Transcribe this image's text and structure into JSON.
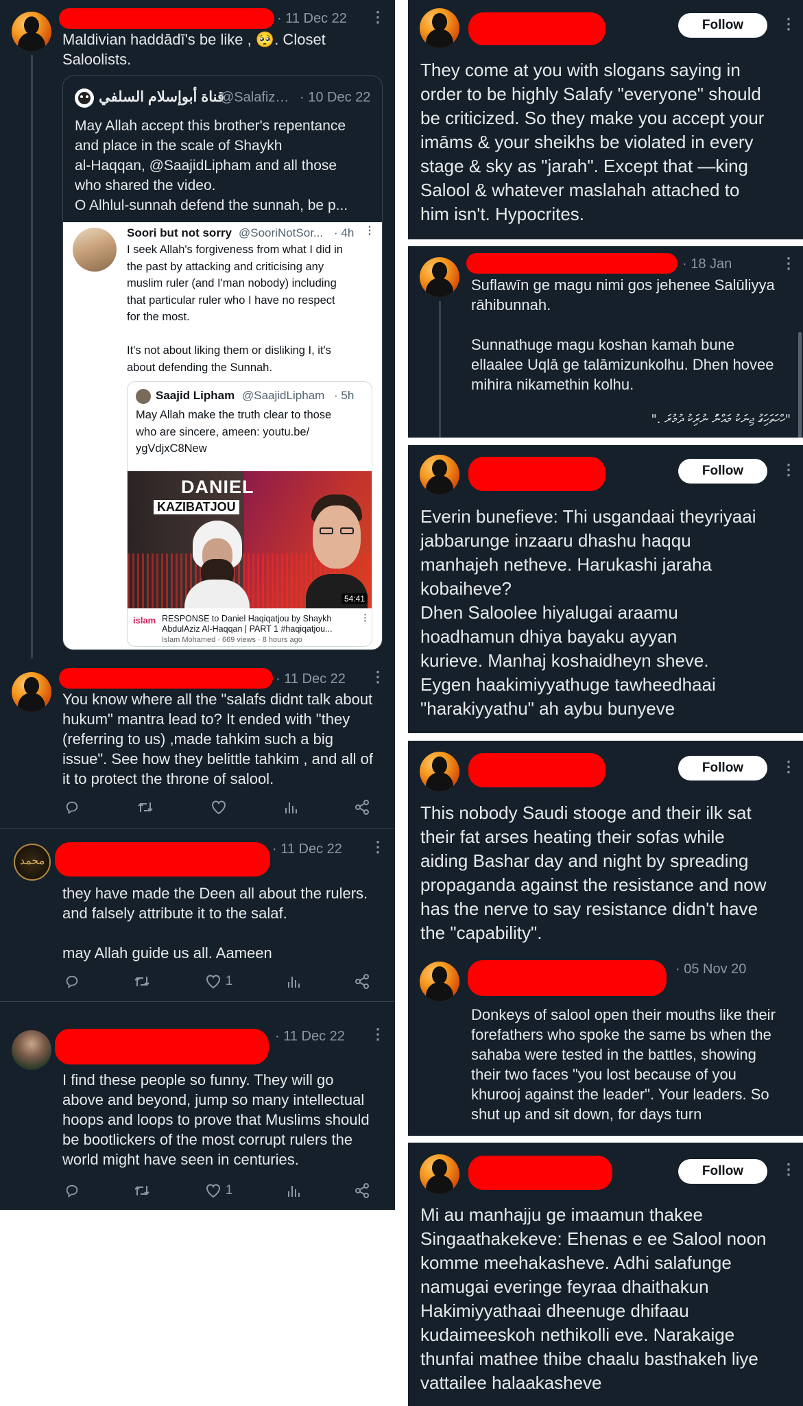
{
  "left": {
    "tweet1": {
      "date": "· 11 Dec 22",
      "text": "Maldivian haddādī's be like , 🥺. Closet\nSaloolists.",
      "quote": {
        "author": "قناة أبوإسلام السلفي",
        "handle": "@Salafiz…",
        "date": "· 10 Dec 22",
        "text": "May Allah accept this brother's repentance\nand place in the scale of Shaykh\nal-Haqqan, @SaajidLipham and all those\nwho shared the video.\nO Alhlul-sunnah defend the sunnah, be p...",
        "inner": {
          "name": "Soori but not sorry",
          "handle": "@SooriNotSor...",
          "date": "· 4h",
          "text": "I seek Allah's forgiveness from what I did in\nthe past by attacking and criticising any\nmuslim ruler (and I'man nobody) including\nthat particular ruler who I have no respect\nfor the most.\n\nIt's not about liking them or disliking I, it's\nabout defending the Sunnah.",
          "nested": {
            "name": "Saajid Lipham",
            "handle": "@SaajidLipham",
            "date": "· 5h",
            "text": "May Allah make the truth clear to those\nwho are sincere, ameen: youtu.be/\nygVdjxC8New",
            "thumb_title": "DANIEL",
            "thumb_sub": "KAZIBATJOU",
            "duration": "54:41",
            "video_title": "RESPONSE to Daniel Haqiqatjou by Shaykh\nAbdulAziz Al-Haqqan | PART 1 #haqiqatjou...",
            "video_meta": "Islam Mohamed · 669 views · 8 hours ago",
            "channel_logo": "islam"
          }
        }
      }
    },
    "tweet2": {
      "date": "· 11 Dec 22",
      "text": "You know where all the \"salafs didnt talk about\nhukum\" mantra lead to? It ended with \"they\n(referring to us) ,made tahkim such a big\nissue\". See how they belittle tahkim , and all of\nit to protect the throne of salool."
    },
    "tweet3": {
      "date": "· 11 Dec 22",
      "avatar_text": "محمد",
      "text": "they have made the Deen all about the rulers.\nand falsely attribute it to the salaf.\n\nmay Allah guide us all. Aameen",
      "likes": "1"
    },
    "tweet4": {
      "date": "· 11 Dec 22",
      "text": "I find these people so funny. They will go\nabove and beyond, jump so many intellectual\nhoops and loops to prove that Muslims should\nbe bootlickers of the most corrupt rulers the\nworld might have seen in centuries.",
      "likes": "1"
    }
  },
  "right": {
    "follow_label": "Follow",
    "post1": {
      "text": "They come at you with slogans saying in\norder to be highly Salafy \"everyone\" should\nbe criticized. So they make you accept your\nimāms & your sheikhs be violated in every\nstage & sky as \"jarah\". Except that —king\nSalool & whatever maslahah attached to\nhim isn't. Hypocrites."
    },
    "post2": {
      "date": "· 18 Jan",
      "text": "Suflawīn ge magu nimi gos jehenee Salūliyya\nrāhibunnah.\n\nSunnathuge magu koshan kamah bune\nellaalee Uqlā ge talāmizunkolhu. Dhen hovee\nmihira nikamethin kolhu.",
      "thaana": "\"ހްހަތަހިަގު ޖިނަކު މައްނުަ ނުރިަކު ދުމުރަ .\""
    },
    "post3": {
      "text": "Everin bunefieve: Thi usgandaai theyriyaai\njabbarunge inzaaru dhashu haqqu\nmanhajeh netheve. Harukashi jaraha\nkobaiheve?\nDhen Saloolee hiyalugai araamu\nhoadhamun dhiya bayaku ayyan\nkurieve. Manhaj koshaidheyn sheve.\nEygen haakimiyyathuge tawheedhaai\n\"harakiyyathu\" ah aybu bunyeve"
    },
    "post4": {
      "text": "This nobody Saudi stooge and their ilk sat\ntheir fat arses heating their sofas while\naiding Bashar day and night by spreading\npropaganda against the resistance and now\nhas the nerve to say resistance didn't have\nthe \"capability\".",
      "reply": {
        "date": "· 05 Nov 20",
        "text": "Donkeys of salool open their mouths like their\nforefathers who spoke the same bs when the\nsahaba were tested in the battles, showing\ntheir two faces \"you lost because of you\nkhurooj against the leader\". Your leaders. So\nshut up and sit down, for days turn"
      }
    },
    "post5": {
      "text": "Mi au manhajju ge imaamun thakee\nSingaathakekeve: Ehenas e ee Salool noon\nkomme meehakasheve. Adhi salafunge\nnamugai everinge feyraa dhaithakun\nHakimiyyathaai dheenuge dhifaau\nkudaimeeskoh nethikolli eve. Narakaige\nthunfai mathee thibe chaalu basthakeh liye\nvattailee halaakasheve"
    }
  },
  "icons": {
    "more": "⋮",
    "reply": "reply-icon",
    "retweet": "retweet-icon",
    "like": "heart-icon",
    "views": "views-icon",
    "share": "share-icon"
  }
}
